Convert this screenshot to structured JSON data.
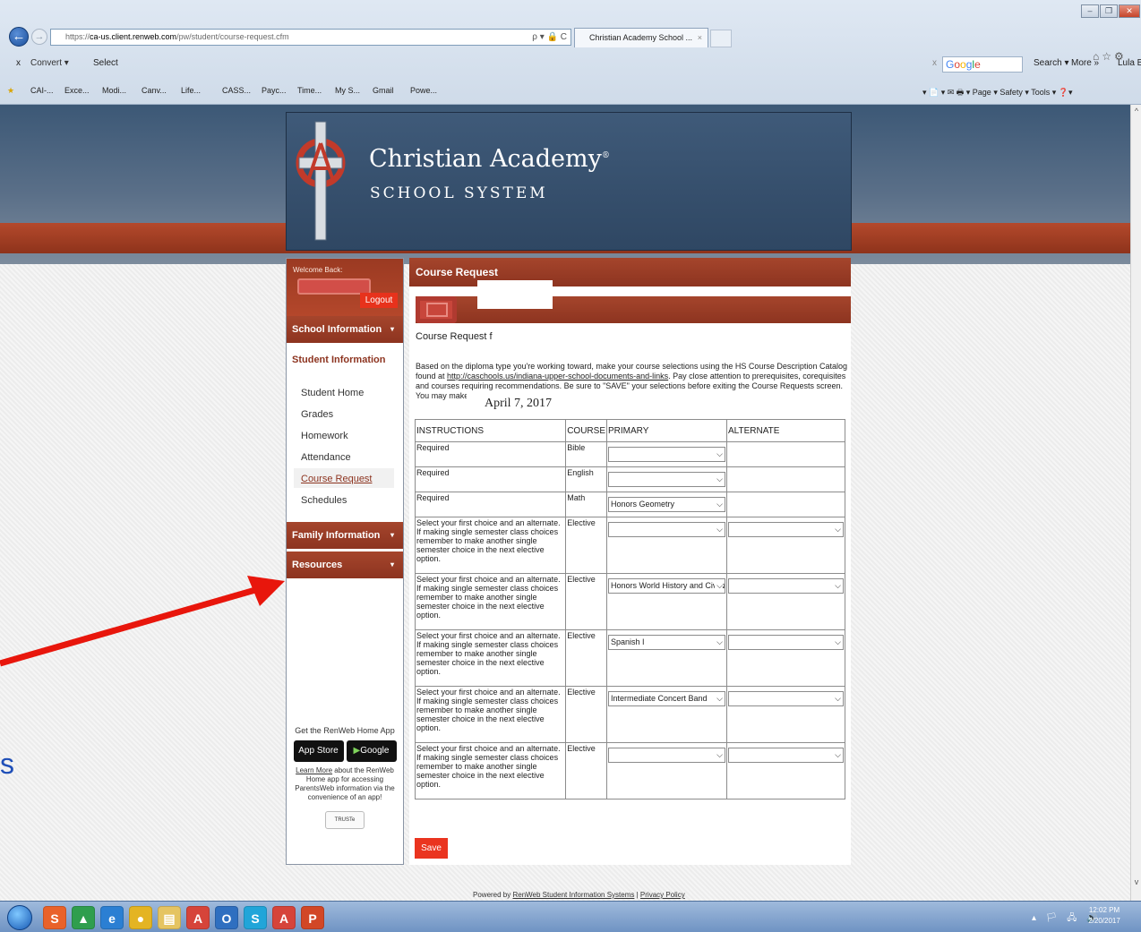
{
  "browser": {
    "url_prefix": "https://",
    "url_host": "ca-us.client.renweb.com",
    "url_path": "/pw/student/course-request.cfm",
    "url_controls": "ρ ▾ 🔒 C",
    "tab_title": "Christian Academy School ...",
    "tab_close": "×",
    "back_glyph": "←",
    "forward_glyph": "→",
    "home_icons": "⌂☆⚙",
    "commands": {
      "close_x": "x",
      "convert": "Convert ▾",
      "select": "Select",
      "google_close": "x",
      "google": [
        "G",
        "o",
        "o",
        "g",
        "l",
        "e"
      ],
      "search": "Search ▾",
      "more": "More »",
      "user": "Lula Be"
    },
    "favorites": [
      "CAI-...",
      "Exce...",
      "Modi...",
      "Canv...",
      "Life...",
      "CASS...",
      "Payc...",
      "Time...",
      "My S...",
      "Gmail",
      "Powe..."
    ],
    "ie_toolbar": "▾ 📄 ▾ ✉ 🖶 ▾ Page ▾ Safety ▾ Tools ▾ ❓▾"
  },
  "school": {
    "name": "Christian Academy",
    "name_mark": "®",
    "subtitle": "SCHOOL SYSTEM"
  },
  "sidebar": {
    "welcome_label": "Welcome Back:",
    "logout": "Logout",
    "school_info": "School Information",
    "student_info": "Student Information",
    "links": [
      "Student Home",
      "Grades",
      "Homework",
      "Attendance",
      "Course Request",
      "Schedules"
    ],
    "family_info": "Family Information",
    "resources": "Resources",
    "caret": "▾",
    "app_title": "Get the RenWeb Home App",
    "app_store": "App Store",
    "google_play": "Google play",
    "learn_link": "Learn More",
    "learn_text": " about the RenWeb Home app for accessing ParentsWeb information via the convenience of an app!",
    "trustee": "TRUSTe"
  },
  "main": {
    "title": "Course Request",
    "course_request_for": "Course Request f",
    "intro_1": "Based on the diploma type you're working toward, make your course selections using the HS Course Description Catalog found at ",
    "catalog_url": "http://caschools.us/indiana-upper-school-documents-and-links",
    "intro_2": ". Pay close attention to prerequisites, corequisites and courses requiring recommendations. Be sure to \"SAVE\" your selections before exiting the Course Requests screen. You may make changes to your requests until Ap",
    "date_overlay": "April 7, 2017",
    "headers": {
      "instructions": "INSTRUCTIONS",
      "course": "COURSE",
      "primary": "PRIMARY",
      "alternate": "ALTERNATE"
    },
    "elective_instruction": "Select your first choice and an alternate. If making single semester class choices remember to make another single semester choice in the next elective option.",
    "rows": [
      {
        "instructions": "Required",
        "course": "Bible",
        "primary": "",
        "alternate": null
      },
      {
        "instructions": "Required",
        "course": "English",
        "primary": "",
        "alternate": null
      },
      {
        "instructions": "Required",
        "course": "Math",
        "primary": "Honors Geometry",
        "alternate": null
      },
      {
        "instructions": "elective",
        "course": "Elective",
        "primary": "",
        "alternate": ""
      },
      {
        "instructions": "elective",
        "course": "Elective",
        "primary": "Honors World History and Civiliza",
        "alternate": ""
      },
      {
        "instructions": "elective",
        "course": "Elective",
        "primary": "Spanish I",
        "alternate": ""
      },
      {
        "instructions": "elective",
        "course": "Elective",
        "primary": "Intermediate Concert Band",
        "alternate": ""
      },
      {
        "instructions": "elective",
        "course": "Elective",
        "primary": "",
        "alternate": ""
      }
    ],
    "chevron": "⌵",
    "save": "Save"
  },
  "footer": {
    "powered_prefix": "Powered by ",
    "powered_link": "RenWeb Student Information Systems",
    "sep": " | ",
    "privacy": "Privacy Policy"
  },
  "stray_letter": "s",
  "taskbar": {
    "clock_time": "12:02 PM",
    "clock_date": "2/20/2017",
    "tray": "▴ 🏳 🖧 🔊"
  },
  "colors": {
    "accent": "#8d3420",
    "save": "#ea341f",
    "arrow": "#e8160c"
  }
}
